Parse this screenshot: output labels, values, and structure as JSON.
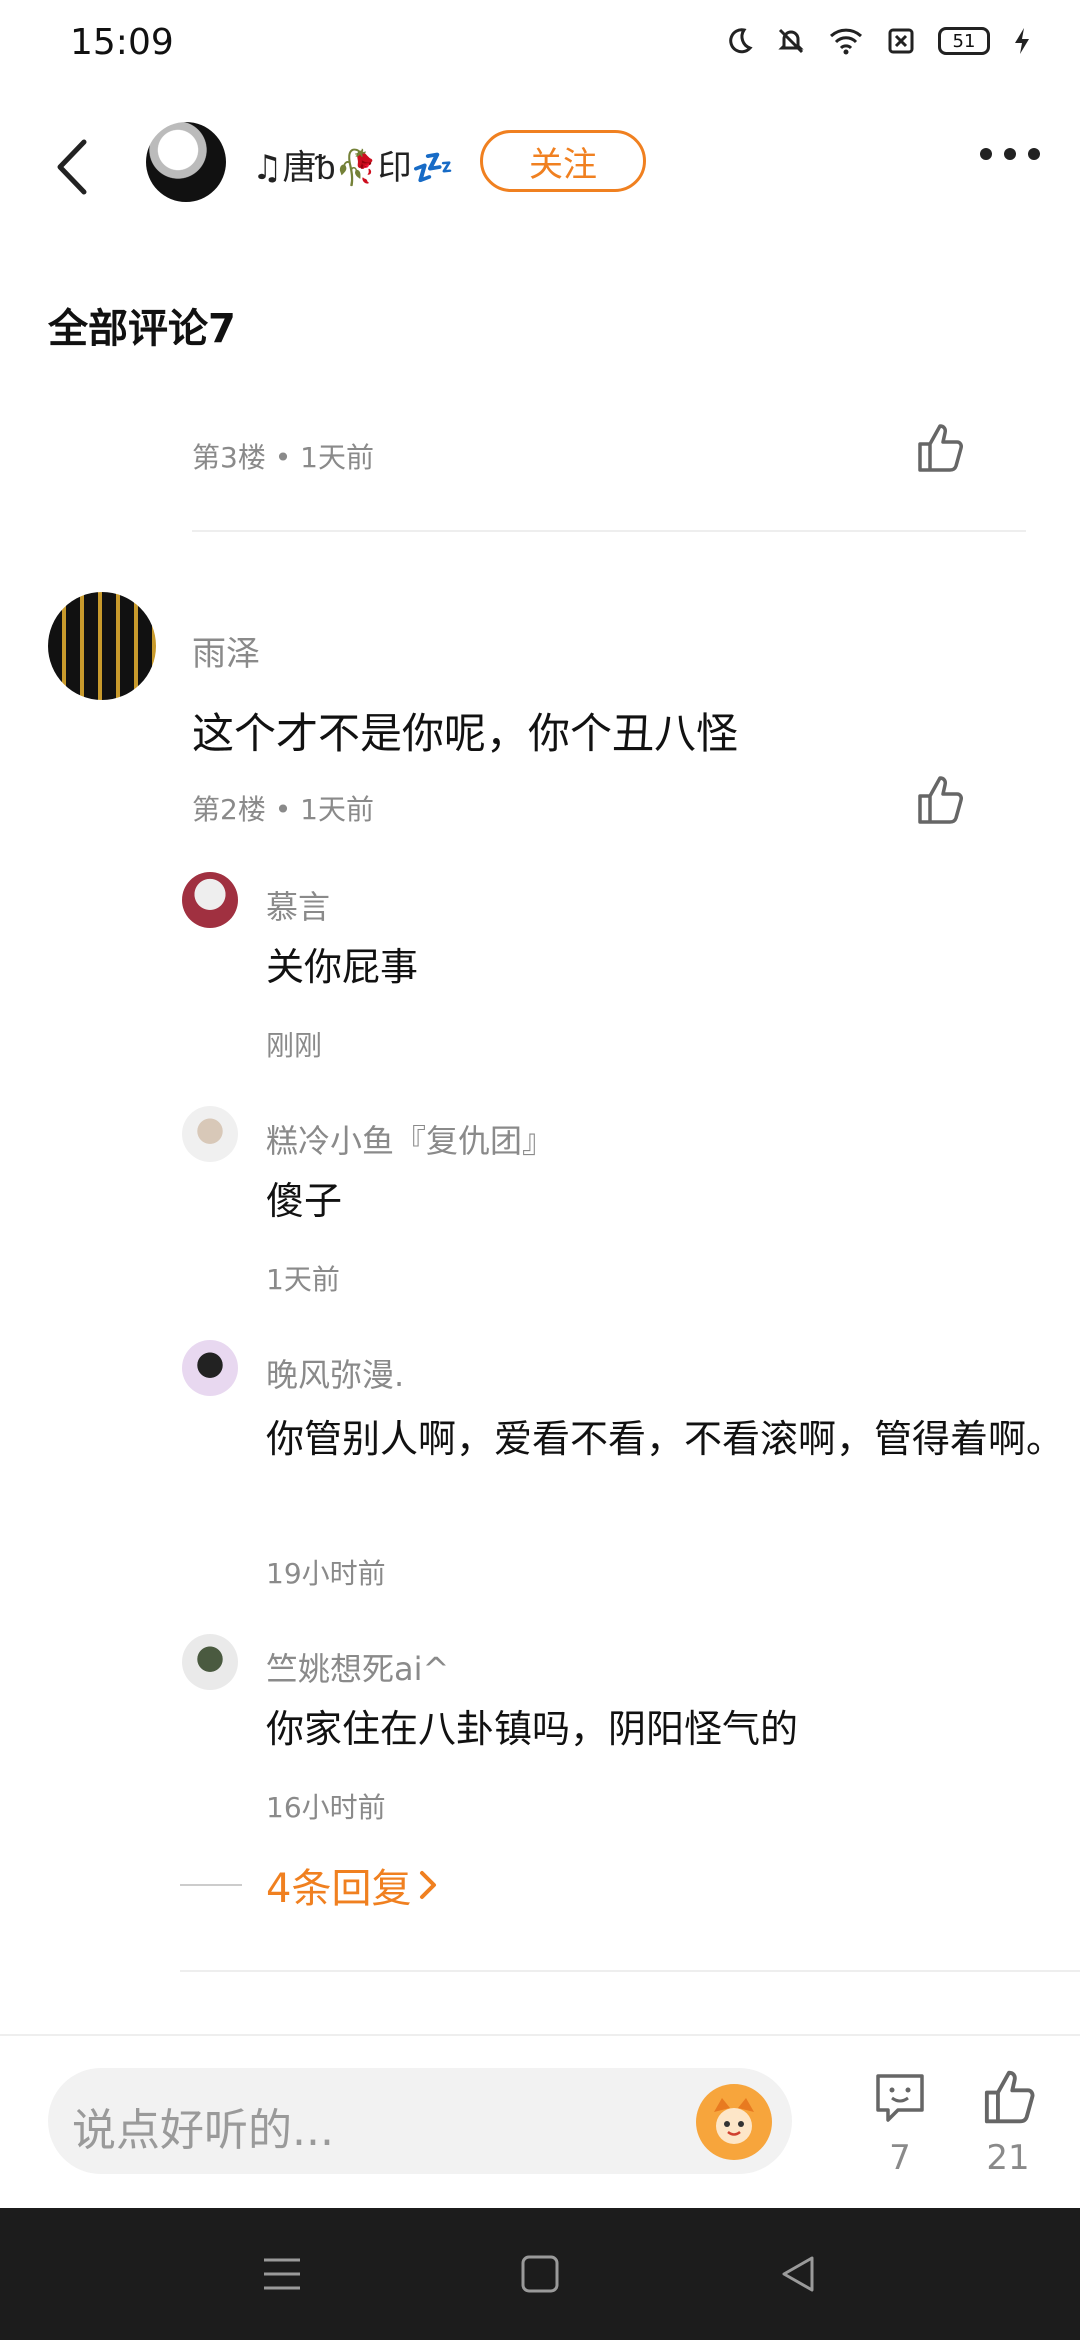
{
  "status_bar": {
    "time": "15:09",
    "battery": "51"
  },
  "header": {
    "username": "♫唐ᵬ🥀印💤",
    "follow_label": "关注"
  },
  "section_title": "全部评论7",
  "comments": [
    {
      "floor_meta": "第3楼 • 1天前"
    },
    {
      "author": "雨泽",
      "text": "这个才不是你呢，你个丑八怪",
      "floor_meta": "第2楼 • 1天前",
      "replies": [
        {
          "author": "慕言",
          "text": "关你屁事",
          "time": "刚刚"
        },
        {
          "author": "糕冷小鱼『复仇团』",
          "text": "傻子",
          "time": "1天前"
        },
        {
          "author": "晚风弥漫.",
          "text": "你管别人啊，爱看不看，不看滚啊，管得着啊。",
          "time": "19小时前"
        },
        {
          "author": "竺姚想死ai^",
          "text": "你家住在八卦镇吗，阴阳怪气的",
          "time": "16小时前"
        }
      ],
      "more_replies_label": "4条回复"
    }
  ],
  "input_bar": {
    "placeholder": "说点好听的...",
    "comment_count": "7",
    "like_count": "21"
  },
  "colors": {
    "accent": "#f08020",
    "meta": "#8a8a8a",
    "nav_bg": "#1c1c1c"
  }
}
